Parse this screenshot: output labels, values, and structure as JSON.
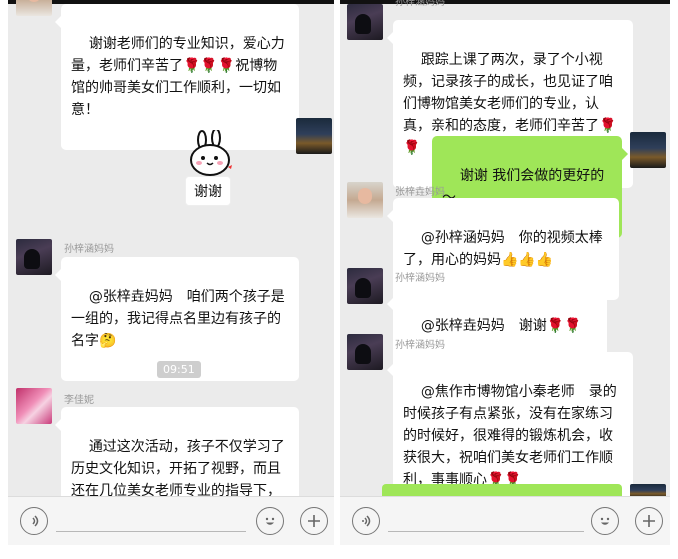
{
  "left": {
    "messages": [
      {
        "text": "谢谢老师们的专业知识，爱心力量，老师们辛苦了🌹🌹🌹祝博物馆的帅哥美女们工作顺利，一切如意！"
      },
      {
        "sticker_text": "谢谢"
      },
      {
        "name": "孙梓涵妈妈",
        "text": "@张梓垚妈妈　咱们两个孩子是一组的，我记得点名里边有孩子的名字🤔"
      },
      {
        "name": "李佳妮",
        "text": "通过这次活动，孩子不仅学习了历史文化知识，开拓了视野，而且还在几位美女老师专业的指导下，锻炼了自己。课程安排的也很合理，"
      }
    ],
    "timestamp": "09:51"
  },
  "right": {
    "messages": [
      {
        "name": "孙梓涵妈妈",
        "text": "跟踪上课了两次，录了个小视频，记录孩子的成长，也见证了咱们博物馆美女老师们的专业，认真，亲和的态度，老师们辛苦了🌹🌹"
      },
      {
        "text": "谢谢 我们会做的更好的～"
      },
      {
        "name": "张梓垚妈妈",
        "text": "@孙梓涵妈妈　你的视频太棒了，用心的妈妈👍👍👍"
      },
      {
        "name": "孙梓涵妈妈",
        "text": "@张梓垚妈妈　谢谢🌹🌹"
      },
      {
        "name": "孙梓涵妈妈",
        "text": "@焦作市博物馆小秦老师　录的时候孩子有点紧张，没有在家练习的时候好，很难得的锻炼机会，收获很大，祝咱们美女老师们工作顺利，事事顺心🌹🌹"
      }
    ]
  },
  "icons": {
    "voice": "voice-icon",
    "emoji": "emoji-icon",
    "plus": "plus-icon"
  },
  "colors": {
    "chat_bg": "#ebebeb",
    "self_bubble": "#9fe658",
    "other_bubble": "#ffffff"
  }
}
